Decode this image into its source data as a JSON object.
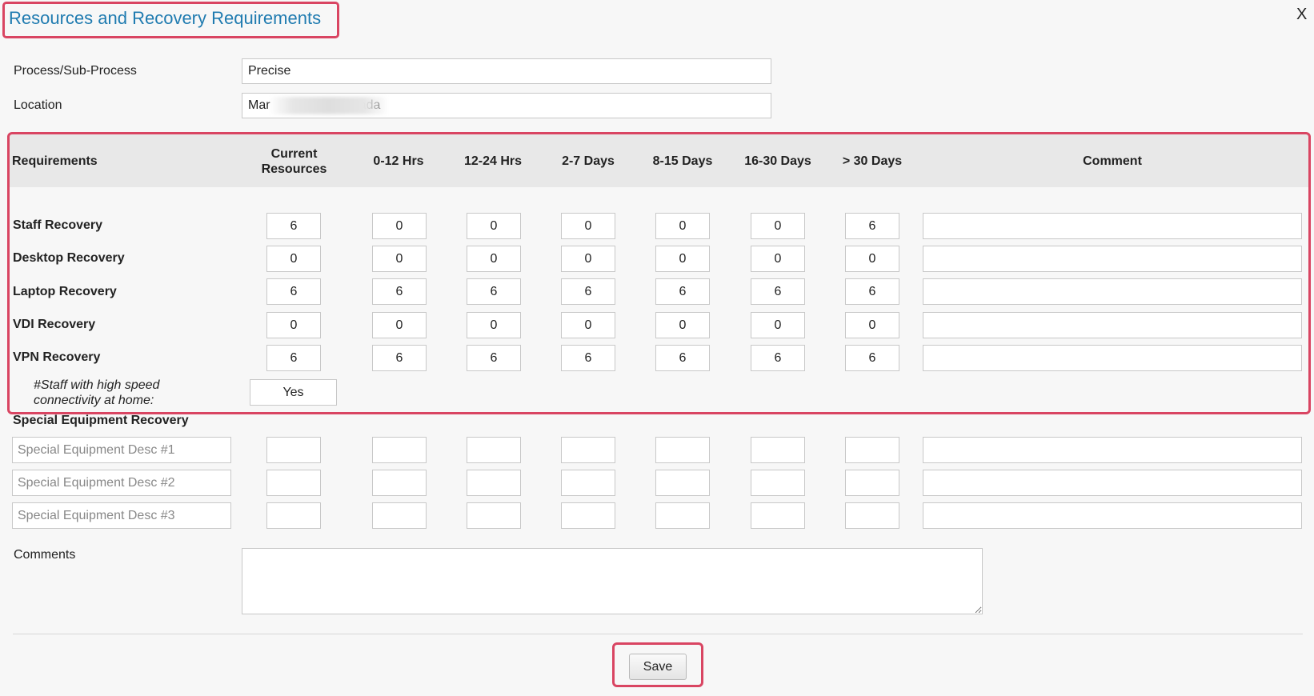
{
  "dialog": {
    "title": "Resources and Recovery Requirements",
    "close_label": "X"
  },
  "fields": {
    "process_label": "Process/Sub-Process",
    "process_value": "Precise",
    "location_label": "Location",
    "location_value": "Mar                         ada"
  },
  "table": {
    "headers": [
      "Requirements",
      "Current Resources",
      "0-12 Hrs",
      "12-24 Hrs",
      "2-7 Days",
      "8-15 Days",
      "16-30 Days",
      "> 30 Days",
      "Comment"
    ],
    "rows": [
      {
        "label": "Staff Recovery",
        "values": [
          "6",
          "0",
          "0",
          "0",
          "0",
          "0",
          "6"
        ],
        "comment": ""
      },
      {
        "label": "Desktop Recovery",
        "values": [
          "0",
          "0",
          "0",
          "0",
          "0",
          "0",
          "0"
        ],
        "comment": ""
      },
      {
        "label": "Laptop Recovery",
        "values": [
          "6",
          "6",
          "6",
          "6",
          "6",
          "6",
          "6"
        ],
        "comment": ""
      },
      {
        "label": "VDI Recovery",
        "values": [
          "0",
          "0",
          "0",
          "0",
          "0",
          "0",
          "0"
        ],
        "comment": ""
      },
      {
        "label": "VPN Recovery",
        "values": [
          "6",
          "6",
          "6",
          "6",
          "6",
          "6",
          "6"
        ],
        "comment": ""
      }
    ],
    "staff_connectivity_label": "#Staff with high speed connectivity at home:",
    "staff_connectivity_value": "Yes"
  },
  "special": {
    "header": "Special Equipment Recovery",
    "rows": [
      {
        "placeholder": "Special Equipment Desc #1"
      },
      {
        "placeholder": "Special Equipment Desc #2"
      },
      {
        "placeholder": "Special Equipment Desc #3"
      }
    ]
  },
  "comments": {
    "label": "Comments",
    "value": ""
  },
  "save_label": "Save",
  "colors": {
    "title": "#1f7bb0",
    "highlight": "#d94562",
    "header_band": "#e8e8e8"
  }
}
